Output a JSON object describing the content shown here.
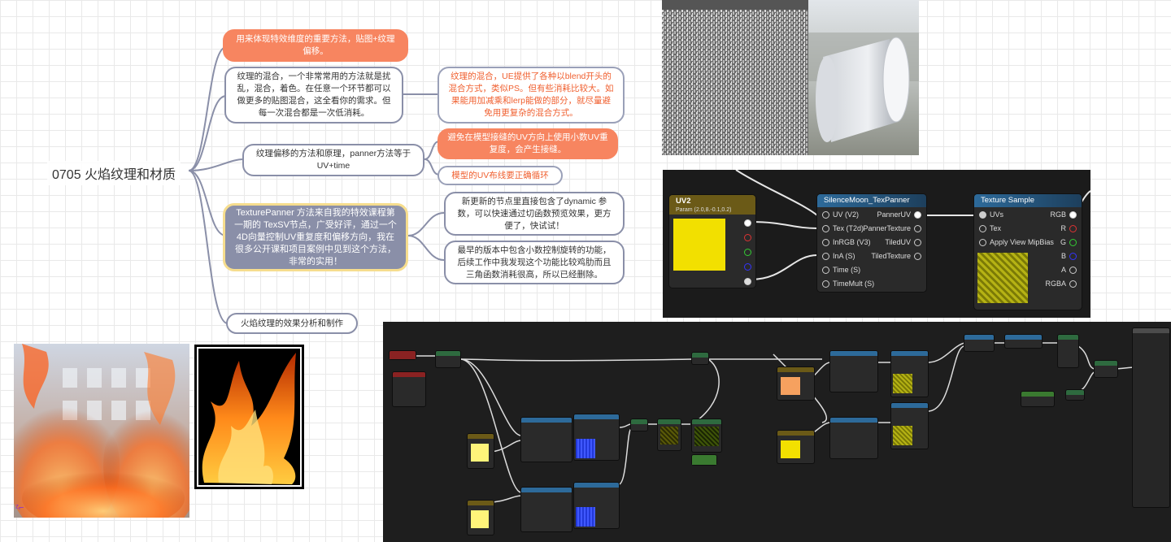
{
  "mindmap": {
    "root": "0705 火焰纹理和材质",
    "branches": [
      {
        "text": "用来体现特效维度的重要方法，贴图+纹理偏移。",
        "style": "orange"
      },
      {
        "text": "纹理的混合，一个非常常用的方法就是扰乱，混合，着色。在任意一个环节都可以做更多的贴图混合，这全看你的需求。但每一次混合都是一次低消耗。",
        "style": "plain"
      },
      {
        "text": "纹理偏移的方法和原理，panner方法等于UV+time",
        "style": "plain"
      },
      {
        "text": "TexturePanner 方法来自我的特效课程第一期的 TexSV节点，广受好评，通过一个4D向量控制UV重复度和偏移方向，我在很多公开课和项目案例中见到这个方法，非常的实用！",
        "style": "highlight"
      },
      {
        "text": "火焰纹理的效果分析和制作",
        "style": "plain"
      }
    ],
    "children": [
      {
        "text": "纹理的混合，UE提供了各种以blend开头的混合方式，类似PS。但有些消耗比较大。如果能用加减乘和lerp能做的部分，就尽量避免用更复杂的混合方式。",
        "style": "orange-text"
      },
      {
        "text": "避免在模型接缝的UV方向上使用小数UV重复度，会产生接缝。",
        "style": "orange"
      },
      {
        "text": "模型的UV布线要正确循环",
        "style": "orange-text"
      },
      {
        "text": "新更新的节点里直接包含了dynamic 参数，可以快速通过切函数预览效果，更方便了，快试试！",
        "style": "plain"
      },
      {
        "text": "最早的版本中包含小数控制旋转的功能，后续工作中我发现这个功能比较鸡肋而且三角函数消耗很高，所以已经删除。",
        "style": "plain"
      }
    ]
  },
  "ue_graph": {
    "param_node": {
      "title": "UV2",
      "subtitle": "Param (2.0,8.-0.1,0.2)",
      "color": "#f2e000"
    },
    "panner_node": {
      "title": "SilenceMoon_TexPanner",
      "inputs": [
        "UV (V2)",
        "Tex (T2d)",
        "InRGB (V3)",
        "InA (S)",
        "Time (S)",
        "TimeMult (S)"
      ],
      "outputs": [
        "PannerUV",
        "PannerTexture",
        "TiledUV",
        "TiledTexture"
      ]
    },
    "texture_node": {
      "title": "Texture Sample",
      "inputs": [
        "UVs",
        "Tex",
        "Apply View MipBias"
      ],
      "outputs": [
        "RGB",
        "R",
        "G",
        "B",
        "A",
        "RGBA"
      ]
    }
  },
  "icons": {
    "axis_gizmo": "axis-gizmo-icon"
  },
  "colors": {
    "orange": "#f78560",
    "node_border": "#8a8fa8",
    "highlight_border": "#f6dd8e",
    "ue_header_blue": "#1d4f7a"
  }
}
